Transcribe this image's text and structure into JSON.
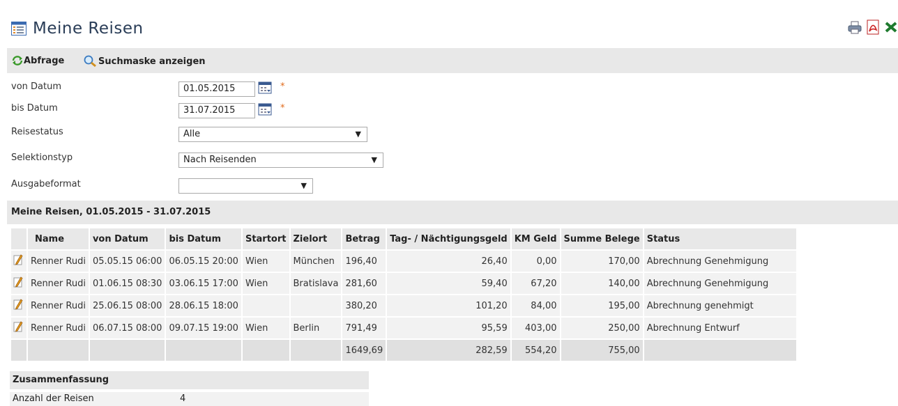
{
  "page": {
    "title": "Meine Reisen"
  },
  "toolbar": {
    "query_label": "Abfrage",
    "search_mask_label": "Suchmaske anzeigen"
  },
  "form": {
    "from_date_label": "von Datum",
    "from_date_value": "01.05.2015",
    "to_date_label": "bis Datum",
    "to_date_value": "31.07.2015",
    "required_marker": "*",
    "status_label": "Reisestatus",
    "status_value": "Alle",
    "selection_type_label": "Selektionstyp",
    "selection_type_value": "Nach Reisenden",
    "output_format_label": "Ausgabeformat",
    "output_format_value": ""
  },
  "results": {
    "title": "Meine Reisen, 01.05.2015 - 31.07.2015",
    "columns": [
      "Name",
      "von Datum",
      "bis Datum",
      "Startort",
      "Zielort",
      "Betrag",
      "Tag- / Nächtigungsgeld",
      "KM Geld",
      "Summe Belege",
      "Status"
    ],
    "rows": [
      [
        "Renner Rudi",
        "05.05.15 06:00",
        "06.05.15 20:00",
        "Wien",
        "München",
        "196,40",
        "26,40",
        "0,00",
        "170,00",
        "Abrechnung Genehmigung"
      ],
      [
        "Renner Rudi",
        "01.06.15 08:30",
        "03.06.15 17:00",
        "Wien",
        "Bratislava",
        "281,60",
        "59,40",
        "67,20",
        "140,00",
        "Abrechnung Genehmigung"
      ],
      [
        "Renner Rudi",
        "25.06.15 08:00",
        "28.06.15 18:00",
        "",
        "",
        "380,20",
        "101,20",
        "84,00",
        "195,00",
        "Abrechnung genehmigt"
      ],
      [
        "Renner Rudi",
        "06.07.15 08:00",
        "09.07.15 19:00",
        "Wien",
        "Berlin",
        "791,49",
        "95,59",
        "403,00",
        "250,00",
        "Abrechnung Entwurf"
      ]
    ],
    "totals": {
      "betrag": "1649,69",
      "tagesgeld": "282,59",
      "km_geld": "554,20",
      "belege": "755,00"
    }
  },
  "summary": {
    "title": "Zusammenfassung",
    "trips_label": "Anzahl der Reisen",
    "trips_value": "4"
  },
  "icons": {
    "title": "calendar-list-icon",
    "print": "printer-icon",
    "pdf": "pdf-icon",
    "excel": "excel-icon",
    "refresh": "refresh-icon",
    "search": "magnifier-icon",
    "calendar": "calendar-icon",
    "edit": "pencil-icon"
  },
  "colors": {
    "title": "#2a3d57",
    "required": "#e06a1a",
    "header_bg": "#e8e8e8",
    "row_bg": "#f2f2f2"
  }
}
